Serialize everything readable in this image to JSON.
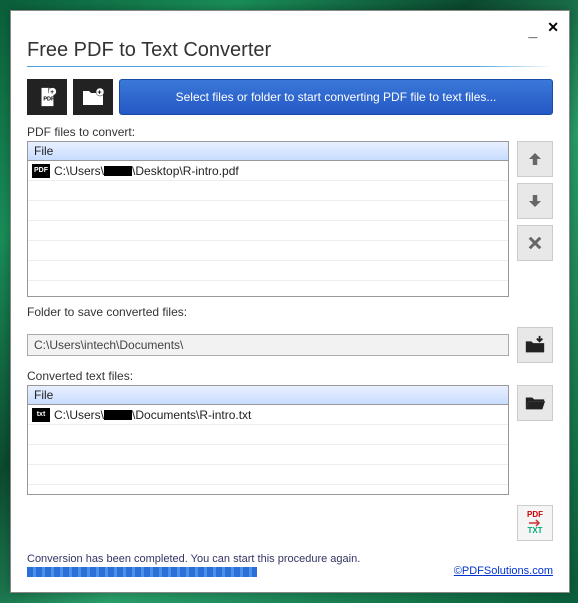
{
  "window": {
    "title": "Free PDF to Text Converter"
  },
  "toolbar": {
    "select_label": "Select files or folder to start converting PDF file to text files..."
  },
  "pdf_section": {
    "label": "PDF files to convert:",
    "header": "File",
    "rows": [
      {
        "icon_text": "PDF",
        "prefix": "C:\\Users\\",
        "suffix": "\\Desktop\\R-intro.pdf"
      }
    ]
  },
  "output": {
    "label": "Folder to save converted files:",
    "path": "C:\\Users\\intech\\Documents\\"
  },
  "txt_section": {
    "label": "Converted text files:",
    "header": "File",
    "rows": [
      {
        "icon_text": "txt",
        "prefix": "C:\\Users\\",
        "suffix": "\\Documents\\R-intro.txt"
      }
    ]
  },
  "status": {
    "text": "Conversion has been completed. You can start this procedure again.",
    "progress_percent": 100
  },
  "footer": {
    "link": "©PDFSolutions.com"
  },
  "convert_button": {
    "top": "PDF",
    "bottom": "TXT"
  }
}
